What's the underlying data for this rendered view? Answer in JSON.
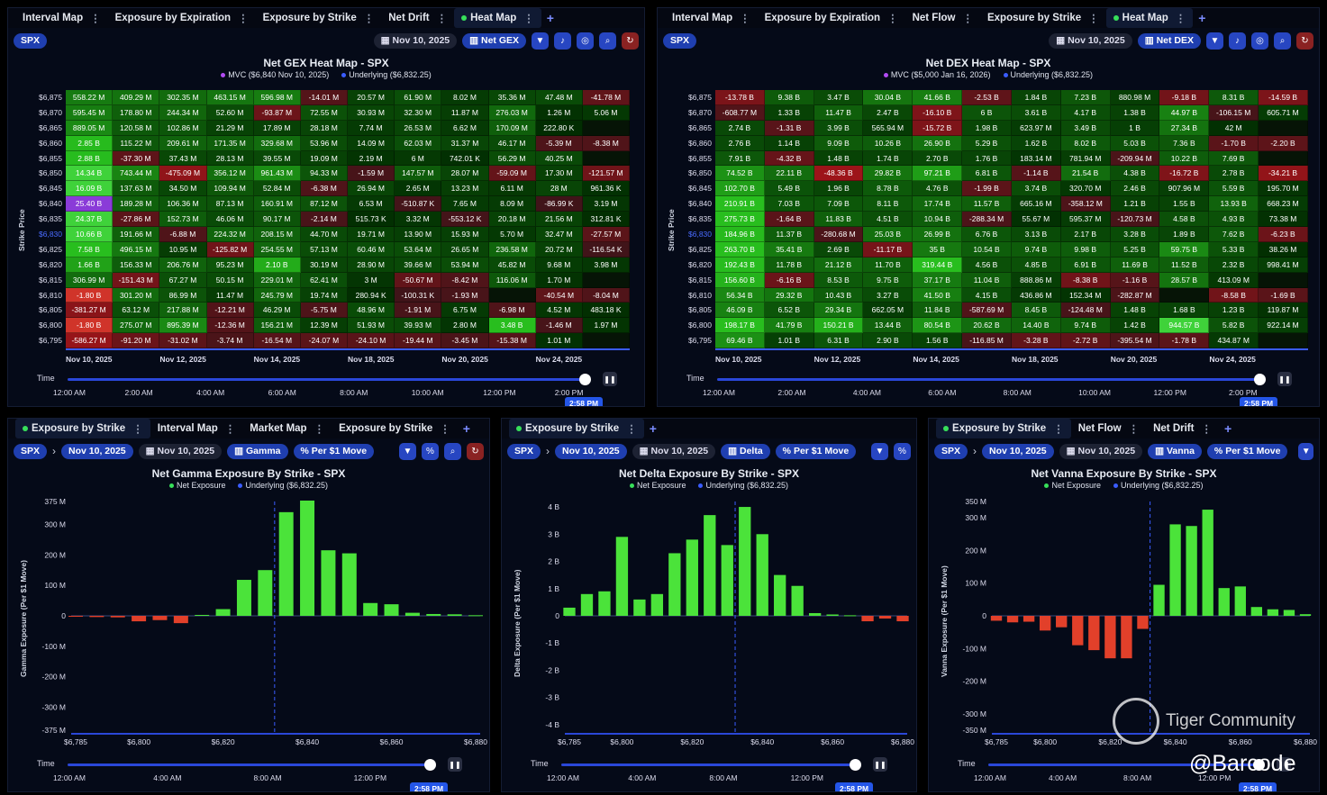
{
  "heat_left": {
    "tabs": [
      {
        "label": "Interval Map"
      },
      {
        "label": "Exposure by Expiration"
      },
      {
        "label": "Exposure by Strike"
      },
      {
        "label": "Net Drift"
      },
      {
        "label": "Heat Map",
        "active": true
      }
    ],
    "ticker": "SPX",
    "date": "Nov 10, 2025",
    "mode": "Net GEX",
    "title": "Net GEX Heat Map - SPX",
    "legend": [
      {
        "label": "MVC ($6,840 Nov 10, 2025)",
        "color": "#b24bf3"
      },
      {
        "label": "Underlying ($6,832.25)",
        "color": "#3a5cff"
      }
    ],
    "ylabel": "Strike Price",
    "strikes": [
      "$6,875",
      "$6,870",
      "$6,865",
      "$6,860",
      "$6,855",
      "$6,850",
      "$6,845",
      "$6,840",
      "$6,835",
      "$6,830",
      "$6,825",
      "$6,820",
      "$6,815",
      "$6,810",
      "$6,805",
      "$6,800",
      "$6,795"
    ],
    "underlying_strike": "$6,830",
    "rows": [
      [
        "558.22 M",
        "409.29 M",
        "302.35 M",
        "463.15 M",
        "596.98 M",
        "-14.01 M",
        "20.57 M",
        "61.90 M",
        "8.02 M",
        "35.36 M",
        "47.48 M",
        "-41.78 M"
      ],
      [
        "595.45 M",
        "178.80 M",
        "244.34 M",
        "52.60 M",
        "-93.87 M",
        "72.55 M",
        "30.93 M",
        "32.30 M",
        "11.87 M",
        "276.03 M",
        "1.26 M",
        "5.06 M"
      ],
      [
        "889.05 M",
        "120.58 M",
        "102.86 M",
        "21.29 M",
        "17.89 M",
        "28.18 M",
        "7.74 M",
        "26.53 M",
        "6.62 M",
        "170.09 M",
        "222.80 K",
        ""
      ],
      [
        "2.85 B",
        "115.22 M",
        "209.61 M",
        "171.35 M",
        "329.68 M",
        "53.96 M",
        "14.09 M",
        "62.03 M",
        "31.37 M",
        "46.17 M",
        "-5.39 M",
        "-8.38 M"
      ],
      [
        "2.88 B",
        "-37.30 M",
        "37.43 M",
        "28.13 M",
        "39.55 M",
        "19.09 M",
        "2.19 M",
        "6 M",
        "742.01 K",
        "56.29 M",
        "40.25 M",
        ""
      ],
      [
        "14.34 B",
        "743.44 M",
        "-475.09 M",
        "356.12 M",
        "961.43 M",
        "94.33 M",
        "-1.59 M",
        "147.57 M",
        "28.07 M",
        "-59.09 M",
        "17.30 M",
        "-121.57 M"
      ],
      [
        "16.09 B",
        "137.63 M",
        "34.50 M",
        "109.94 M",
        "52.84 M",
        "-6.38 M",
        "26.94 M",
        "2.65 M",
        "13.23 M",
        "6.11 M",
        "28 M",
        "961.36 K"
      ],
      [
        "25.40 B",
        "189.28 M",
        "106.36 M",
        "87.13 M",
        "160.91 M",
        "87.12 M",
        "6.53 M",
        "-510.87 K",
        "7.65 M",
        "8.09 M",
        "-86.99 K",
        "3.19 M"
      ],
      [
        "24.37 B",
        "-27.86 M",
        "152.73 M",
        "46.06 M",
        "90.17 M",
        "-2.14 M",
        "515.73 K",
        "3.32 M",
        "-553.12 K",
        "20.18 M",
        "21.56 M",
        "312.81 K"
      ],
      [
        "10.66 B",
        "191.66 M",
        "-6.88 M",
        "224.32 M",
        "208.15 M",
        "44.70 M",
        "19.71 M",
        "13.90 M",
        "15.93 M",
        "5.70 M",
        "32.47 M",
        "-27.57 M"
      ],
      [
        "7.58 B",
        "496.15 M",
        "10.95 M",
        "-125.82 M",
        "254.55 M",
        "57.13 M",
        "60.46 M",
        "53.64 M",
        "26.65 M",
        "236.58 M",
        "20.72 M",
        "-116.54 K"
      ],
      [
        "1.66 B",
        "156.33 M",
        "206.76 M",
        "95.23 M",
        "2.10 B",
        "30.19 M",
        "28.90 M",
        "39.66 M",
        "53.94 M",
        "45.82 M",
        "9.68 M",
        "3.98 M"
      ],
      [
        "306.99 M",
        "-151.43 M",
        "67.27 M",
        "50.15 M",
        "229.01 M",
        "62.41 M",
        "3 M",
        "-50.67 M",
        "-8.42 M",
        "116.06 M",
        "1.70 M",
        ""
      ],
      [
        "-1.80 B",
        "301.20 M",
        "86.99 M",
        "11.47 M",
        "245.79 M",
        "19.74 M",
        "280.94 K",
        "-100.31 K",
        "-1.93 M",
        "",
        "-40.54 M",
        "-8.04 M"
      ],
      [
        "-381.27 M",
        "63.12 M",
        "217.88 M",
        "-12.21 M",
        "46.29 M",
        "-5.75 M",
        "48.96 M",
        "-1.91 M",
        "6.75 M",
        "-6.98 M",
        "4.52 M",
        "483.18 K"
      ],
      [
        "-1.80 B",
        "275.07 M",
        "895.39 M",
        "-12.36 M",
        "156.21 M",
        "12.39 M",
        "51.93 M",
        "39.93 M",
        "2.80 M",
        "3.48 B",
        "-1.46 M",
        "1.97 M"
      ],
      [
        "-586.27 M",
        "-91.20 M",
        "-31.02 M",
        "-3.74 M",
        "-16.54 M",
        "-24.07 M",
        "-24.10 M",
        "-19.44 M",
        "-3.45 M",
        "-15.38 M",
        "1.01 M",
        ""
      ]
    ],
    "dates": [
      "Nov 10, 2025",
      "Nov 12, 2025",
      "Nov 14, 2025",
      "Nov 18, 2025",
      "Nov 20, 2025",
      "Nov 24, 2025"
    ],
    "time_label": "Time",
    "times": [
      "12:00 AM",
      "2:00 AM",
      "4:00 AM",
      "6:00 AM",
      "8:00 AM",
      "10:00 AM",
      "12:00 PM",
      "2:00 PM"
    ],
    "current_time": "2:58 PM"
  },
  "heat_right": {
    "tabs": [
      {
        "label": "Interval Map"
      },
      {
        "label": "Exposure by Expiration"
      },
      {
        "label": "Net Flow"
      },
      {
        "label": "Exposure by Strike"
      },
      {
        "label": "Heat Map",
        "active": true
      }
    ],
    "ticker": "SPX",
    "date": "Nov 10, 2025",
    "mode": "Net DEX",
    "title": "Net DEX Heat Map - SPX",
    "legend": [
      {
        "label": "MVC ($5,000 Jan 16, 2026)",
        "color": "#b24bf3"
      },
      {
        "label": "Underlying ($6,832.25)",
        "color": "#3a5cff"
      }
    ],
    "ylabel": "Strike Price",
    "strikes": [
      "$6,875",
      "$6,870",
      "$6,865",
      "$6,860",
      "$6,855",
      "$6,850",
      "$6,845",
      "$6,840",
      "$6,835",
      "$6,830",
      "$6,825",
      "$6,820",
      "$6,815",
      "$6,810",
      "$6,805",
      "$6,800",
      "$6,795"
    ],
    "underlying_strike": "$6,830",
    "rows": [
      [
        "-13.78 B",
        "9.38 B",
        "3.47 B",
        "30.04 B",
        "41.66 B",
        "-2.53 B",
        "1.84 B",
        "7.23 B",
        "880.98 M",
        "-9.18 B",
        "8.31 B",
        "-14.59 B"
      ],
      [
        "-608.77 M",
        "1.33 B",
        "11.47 B",
        "2.47 B",
        "-16.10 B",
        "6 B",
        "3.61 B",
        "4.17 B",
        "1.38 B",
        "44.97 B",
        "-106.15 M",
        "605.71 M"
      ],
      [
        "2.74 B",
        "-1.31 B",
        "3.99 B",
        "565.94 M",
        "-15.72 B",
        "1.98 B",
        "623.97 M",
        "3.49 B",
        "1 B",
        "27.34 B",
        "42 M",
        ""
      ],
      [
        "2.76 B",
        "1.14 B",
        "9.09 B",
        "10.26 B",
        "26.90 B",
        "5.29 B",
        "1.62 B",
        "8.02 B",
        "5.03 B",
        "7.36 B",
        "-1.70 B",
        "-2.20 B"
      ],
      [
        "7.91 B",
        "-4.32 B",
        "1.48 B",
        "1.74 B",
        "2.70 B",
        "1.76 B",
        "183.14 M",
        "781.94 M",
        "-209.94 M",
        "10.22 B",
        "7.69 B",
        ""
      ],
      [
        "74.52 B",
        "22.11 B",
        "-48.36 B",
        "29.82 B",
        "97.21 B",
        "6.81 B",
        "-1.14 B",
        "21.54 B",
        "4.38 B",
        "-16.72 B",
        "2.78 B",
        "-34.21 B"
      ],
      [
        "102.70 B",
        "5.49 B",
        "1.96 B",
        "8.78 B",
        "4.76 B",
        "-1.99 B",
        "3.74 B",
        "320.70 M",
        "2.46 B",
        "907.96 M",
        "5.59 B",
        "195.70 M"
      ],
      [
        "210.91 B",
        "7.03 B",
        "7.09 B",
        "8.11 B",
        "17.74 B",
        "11.57 B",
        "665.16 M",
        "-358.12 M",
        "1.21 B",
        "1.55 B",
        "13.93 B",
        "668.23 M"
      ],
      [
        "275.73 B",
        "-1.64 B",
        "11.83 B",
        "4.51 B",
        "10.94 B",
        "-288.34 M",
        "55.67 M",
        "595.37 M",
        "-120.73 M",
        "4.58 B",
        "4.93 B",
        "73.38 M"
      ],
      [
        "184.96 B",
        "11.37 B",
        "-280.68 M",
        "25.03 B",
        "26.99 B",
        "6.76 B",
        "3.13 B",
        "2.17 B",
        "3.28 B",
        "1.89 B",
        "7.62 B",
        "-6.23 B"
      ],
      [
        "263.70 B",
        "35.41 B",
        "2.69 B",
        "-11.17 B",
        "35 B",
        "10.54 B",
        "9.74 B",
        "9.98 B",
        "5.25 B",
        "59.75 B",
        "5.33 B",
        "38.26 M"
      ],
      [
        "192.43 B",
        "11.78 B",
        "21.12 B",
        "11.70 B",
        "319.44 B",
        "4.56 B",
        "4.85 B",
        "6.91 B",
        "11.69 B",
        "11.52 B",
        "2.32 B",
        "998.41 M"
      ],
      [
        "156.60 B",
        "-6.16 B",
        "8.53 B",
        "9.75 B",
        "37.17 B",
        "11.04 B",
        "888.86 M",
        "-8.38 B",
        "-1.16 B",
        "28.57 B",
        "413.09 M",
        ""
      ],
      [
        "56.34 B",
        "29.32 B",
        "10.43 B",
        "3.27 B",
        "41.50 B",
        "4.15 B",
        "436.86 M",
        "152.34 M",
        "-282.87 M",
        "",
        "-8.58 B",
        "-1.69 B"
      ],
      [
        "46.09 B",
        "6.52 B",
        "29.34 B",
        "662.05 M",
        "11.84 B",
        "-587.69 M",
        "8.45 B",
        "-124.48 M",
        "1.48 B",
        "1.68 B",
        "1.23 B",
        "119.87 M"
      ],
      [
        "198.17 B",
        "41.79 B",
        "150.21 B",
        "13.44 B",
        "80.54 B",
        "20.62 B",
        "14.40 B",
        "9.74 B",
        "1.42 B",
        "944.57 B",
        "5.82 B",
        "922.14 M"
      ],
      [
        "69.46 B",
        "1.01 B",
        "6.31 B",
        "2.90 B",
        "1.56 B",
        "-116.85 M",
        "-3.28 B",
        "-2.72 B",
        "-395.54 M",
        "-1.78 B",
        "434.87 M",
        ""
      ]
    ],
    "dates": [
      "Nov 10, 2025",
      "Nov 12, 2025",
      "Nov 14, 2025",
      "Nov 18, 2025",
      "Nov 20, 2025",
      "Nov 24, 2025"
    ],
    "time_label": "Time",
    "times": [
      "12:00 AM",
      "2:00 AM",
      "4:00 AM",
      "6:00 AM",
      "8:00 AM",
      "10:00 AM",
      "12:00 PM",
      "2:00 PM"
    ],
    "current_time": "2:58 PM"
  },
  "gamma": {
    "tabs": [
      {
        "label": "Exposure by Strike",
        "active": true,
        "dot": true
      },
      {
        "label": "Interval Map"
      },
      {
        "label": "Market Map"
      },
      {
        "label": "Exposure by Strike"
      }
    ],
    "ticker": "SPX",
    "exp_date": "Nov 10, 2025",
    "date": "Nov 10, 2025",
    "greek": "Gamma",
    "unit": "Per $1 Move",
    "time_label": "Time",
    "times": [
      "12:00 AM",
      "4:00 AM",
      "8:00 AM",
      "12:00 PM"
    ],
    "current_time": "2:58 PM"
  },
  "delta": {
    "tabs": [
      {
        "label": "Exposure by Strike",
        "active": true,
        "dot": true
      }
    ],
    "ticker": "SPX",
    "exp_date": "Nov 10, 2025",
    "date": "Nov 10, 2025",
    "greek": "Delta",
    "unit": "Per $1 Move",
    "time_label": "Time",
    "times": [
      "12:00 AM",
      "4:00 AM",
      "8:00 AM",
      "12:00 PM"
    ],
    "current_time": "2:58 PM"
  },
  "vanna": {
    "tabs": [
      {
        "label": "Exposure by Strike",
        "active": true,
        "dot": true
      },
      {
        "label": "Net Flow"
      },
      {
        "label": "Net Drift"
      }
    ],
    "ticker": "SPX",
    "exp_date": "Nov 10, 2025",
    "date": "Nov 10, 2025",
    "greek": "Vanna",
    "unit": "Per $1 Move",
    "time_label": "Time",
    "times": [
      "12:00 AM",
      "4:00 AM",
      "8:00 AM",
      "12:00 PM"
    ],
    "current_time": "2:58 PM"
  },
  "watermark": {
    "brand": "Tiger Community",
    "handle": "@Barcode"
  },
  "chart_data": [
    {
      "type": "bar",
      "title": "Net Gamma Exposure By Strike - SPX",
      "legend": [
        "Net Exposure",
        "Underlying ($6,832.25)"
      ],
      "ylabel": "Gamma Exposure (Per $1 Move)",
      "xlabel": "",
      "x_ticks": [
        "$6,785",
        "$6,800",
        "$6,820",
        "$6,840",
        "$6,860",
        "$6,880"
      ],
      "y_ticks": [
        "375 M",
        "300 M",
        "200 M",
        "100 M",
        "0",
        "-100 M",
        "-200 M",
        "-300 M",
        "-375 M"
      ],
      "ylim": [
        -375,
        375
      ],
      "underlying": 6832.25,
      "x": [
        6785,
        6790,
        6795,
        6800,
        6805,
        6810,
        6815,
        6820,
        6825,
        6830,
        6835,
        6840,
        6845,
        6850,
        6855,
        6860,
        6865,
        6870,
        6875,
        6880
      ],
      "values": [
        -3,
        -4,
        -5,
        -18,
        -14,
        -24,
        3,
        22,
        118,
        150,
        340,
        378,
        215,
        205,
        42,
        38,
        10,
        6,
        5,
        2
      ]
    },
    {
      "type": "bar",
      "title": "Net Delta Exposure By Strike - SPX",
      "legend": [
        "Net Exposure",
        "Underlying ($6,832.25)"
      ],
      "ylabel": "Delta Exposure (Per $1 Move)",
      "xlabel": "",
      "x_ticks": [
        "$6,785",
        "$6,800",
        "$6,820",
        "$6,840",
        "$6,860",
        "$6,880"
      ],
      "y_ticks": [
        "4 B",
        "3 B",
        "2 B",
        "1 B",
        "0",
        "-1 B",
        "-2 B",
        "-3 B",
        "-4 B"
      ],
      "ylim": [
        -4.2,
        4.2
      ],
      "underlying": 6832.25,
      "x": [
        6785,
        6790,
        6795,
        6800,
        6805,
        6810,
        6815,
        6820,
        6825,
        6830,
        6835,
        6840,
        6845,
        6850,
        6855,
        6860,
        6865,
        6870,
        6875,
        6880
      ],
      "values": [
        0.3,
        0.8,
        0.9,
        2.9,
        0.6,
        0.8,
        2.3,
        2.8,
        3.7,
        2.6,
        4.0,
        3.0,
        1.5,
        1.1,
        0.1,
        0.05,
        0.02,
        -0.2,
        -0.1,
        -0.2
      ]
    },
    {
      "type": "bar",
      "title": "Net Vanna Exposure By Strike - SPX",
      "legend": [
        "Net Exposure",
        "Underlying ($6,832.25)"
      ],
      "ylabel": "Vanna Exposure (Per $1 Move)",
      "xlabel": "",
      "x_ticks": [
        "$6,785",
        "$6,800",
        "$6,820",
        "$6,840",
        "$6,860",
        "$6,880"
      ],
      "y_ticks": [
        "350 M",
        "300 M",
        "200 M",
        "100 M",
        "0",
        "-100 M",
        "-200 M",
        "-300 M",
        "-350 M"
      ],
      "ylim": [
        -350,
        350
      ],
      "underlying": 6832.25,
      "x": [
        6785,
        6790,
        6795,
        6800,
        6805,
        6810,
        6815,
        6820,
        6825,
        6830,
        6835,
        6840,
        6845,
        6850,
        6855,
        6860,
        6865,
        6870,
        6875,
        6880
      ],
      "values": [
        -15,
        -20,
        -18,
        -45,
        -35,
        -90,
        -105,
        -130,
        -130,
        -40,
        95,
        280,
        275,
        325,
        85,
        90,
        27,
        20,
        18,
        5
      ]
    }
  ]
}
